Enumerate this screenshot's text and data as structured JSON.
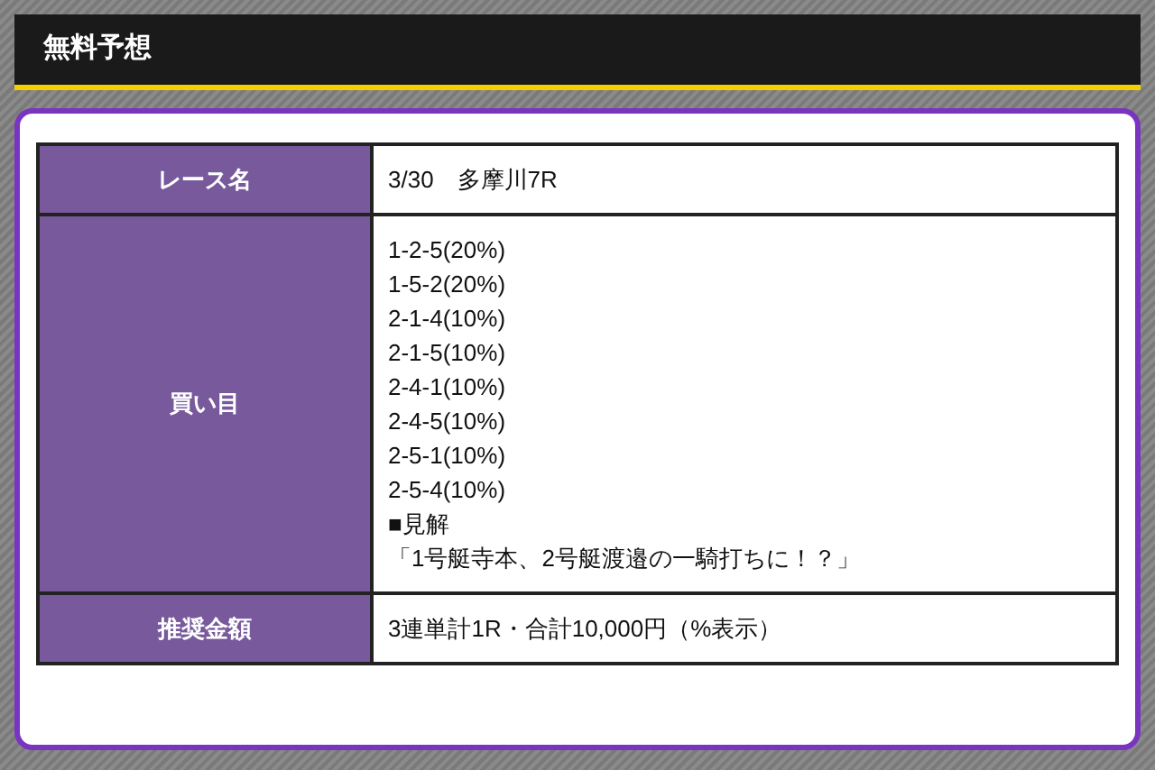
{
  "header": {
    "title": "無料予想"
  },
  "table": {
    "rows": [
      {
        "label": "レース名",
        "lines": [
          "3/30　多摩川7R"
        ]
      },
      {
        "label": "買い目",
        "lines": [
          "1-2-5(20%)",
          "1-5-2(20%)",
          "2-1-4(10%)",
          "2-1-5(10%)",
          "2-4-1(10%)",
          "2-4-5(10%)",
          "2-5-1(10%)",
          "2-5-4(10%)",
          "■見解",
          "「1号艇寺本、2号艇渡邉の一騎打ちに！？」"
        ]
      },
      {
        "label": "推奨金額",
        "lines": [
          "3連単計1R・合計10,000円（%表示）"
        ]
      }
    ]
  }
}
